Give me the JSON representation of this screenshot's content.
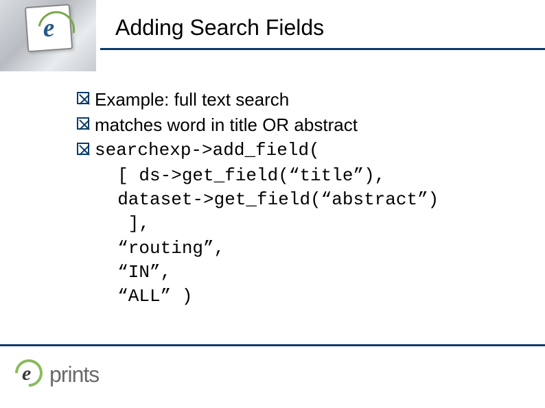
{
  "slide": {
    "title": "Adding Search Fields",
    "bullets": [
      {
        "text": "Example: full text search",
        "mono": false
      },
      {
        "text": "matches word in title OR abstract",
        "mono": false
      }
    ],
    "code": {
      "line0": "searchexp->add_field(",
      "line1": "  [ ds->get_field(“title”),",
      "line2": "  dataset->get_field(“abstract”)",
      "line3": "   ],",
      "line4": "  “routing”,",
      "line5": "  “IN”,",
      "line6": "  “ALL” )"
    },
    "footer_brand": "prints",
    "footer_brand_e": "e"
  }
}
